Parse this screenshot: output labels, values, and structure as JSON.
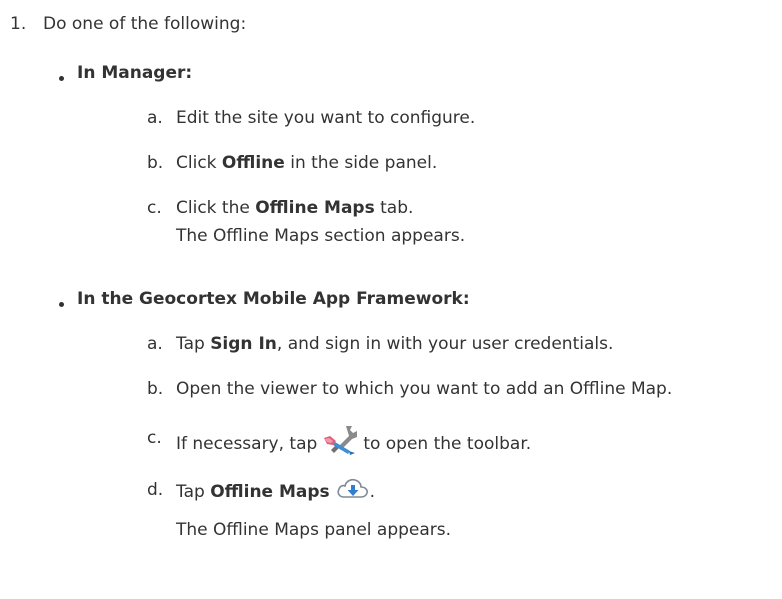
{
  "step": {
    "number": "1.",
    "intro": "Do one of the following:"
  },
  "manager": {
    "heading": "In Manager:",
    "items": [
      {
        "letter": "a.",
        "text": "Edit the site you want to configure."
      },
      {
        "letter": "b.",
        "pre": "Click ",
        "bold": "Offline",
        "post": " in the side panel."
      },
      {
        "letter": "c.",
        "pre": "Click the ",
        "bold": "Offline Maps",
        "post": " tab."
      }
    ],
    "result": "The Offline Maps section appears."
  },
  "framework": {
    "heading": "In the Geocortex Mobile App Framework:",
    "items": [
      {
        "letter": "a.",
        "pre": "Tap ",
        "bold": "Sign In",
        "post": ", and sign in with your user credentials."
      },
      {
        "letter": "b.",
        "text": "Open the viewer to which you want to add an Offline Map."
      },
      {
        "letter": "c.",
        "pre": "If necessary, tap",
        "icon": "wrench-screwdriver-icon",
        "post": "to open the toolbar."
      },
      {
        "letter": "d.",
        "pre": "Tap ",
        "bold": "Offline Maps",
        "icon": "cloud-download-icon",
        "post": "."
      }
    ],
    "result": "The Offline Maps panel appears."
  }
}
